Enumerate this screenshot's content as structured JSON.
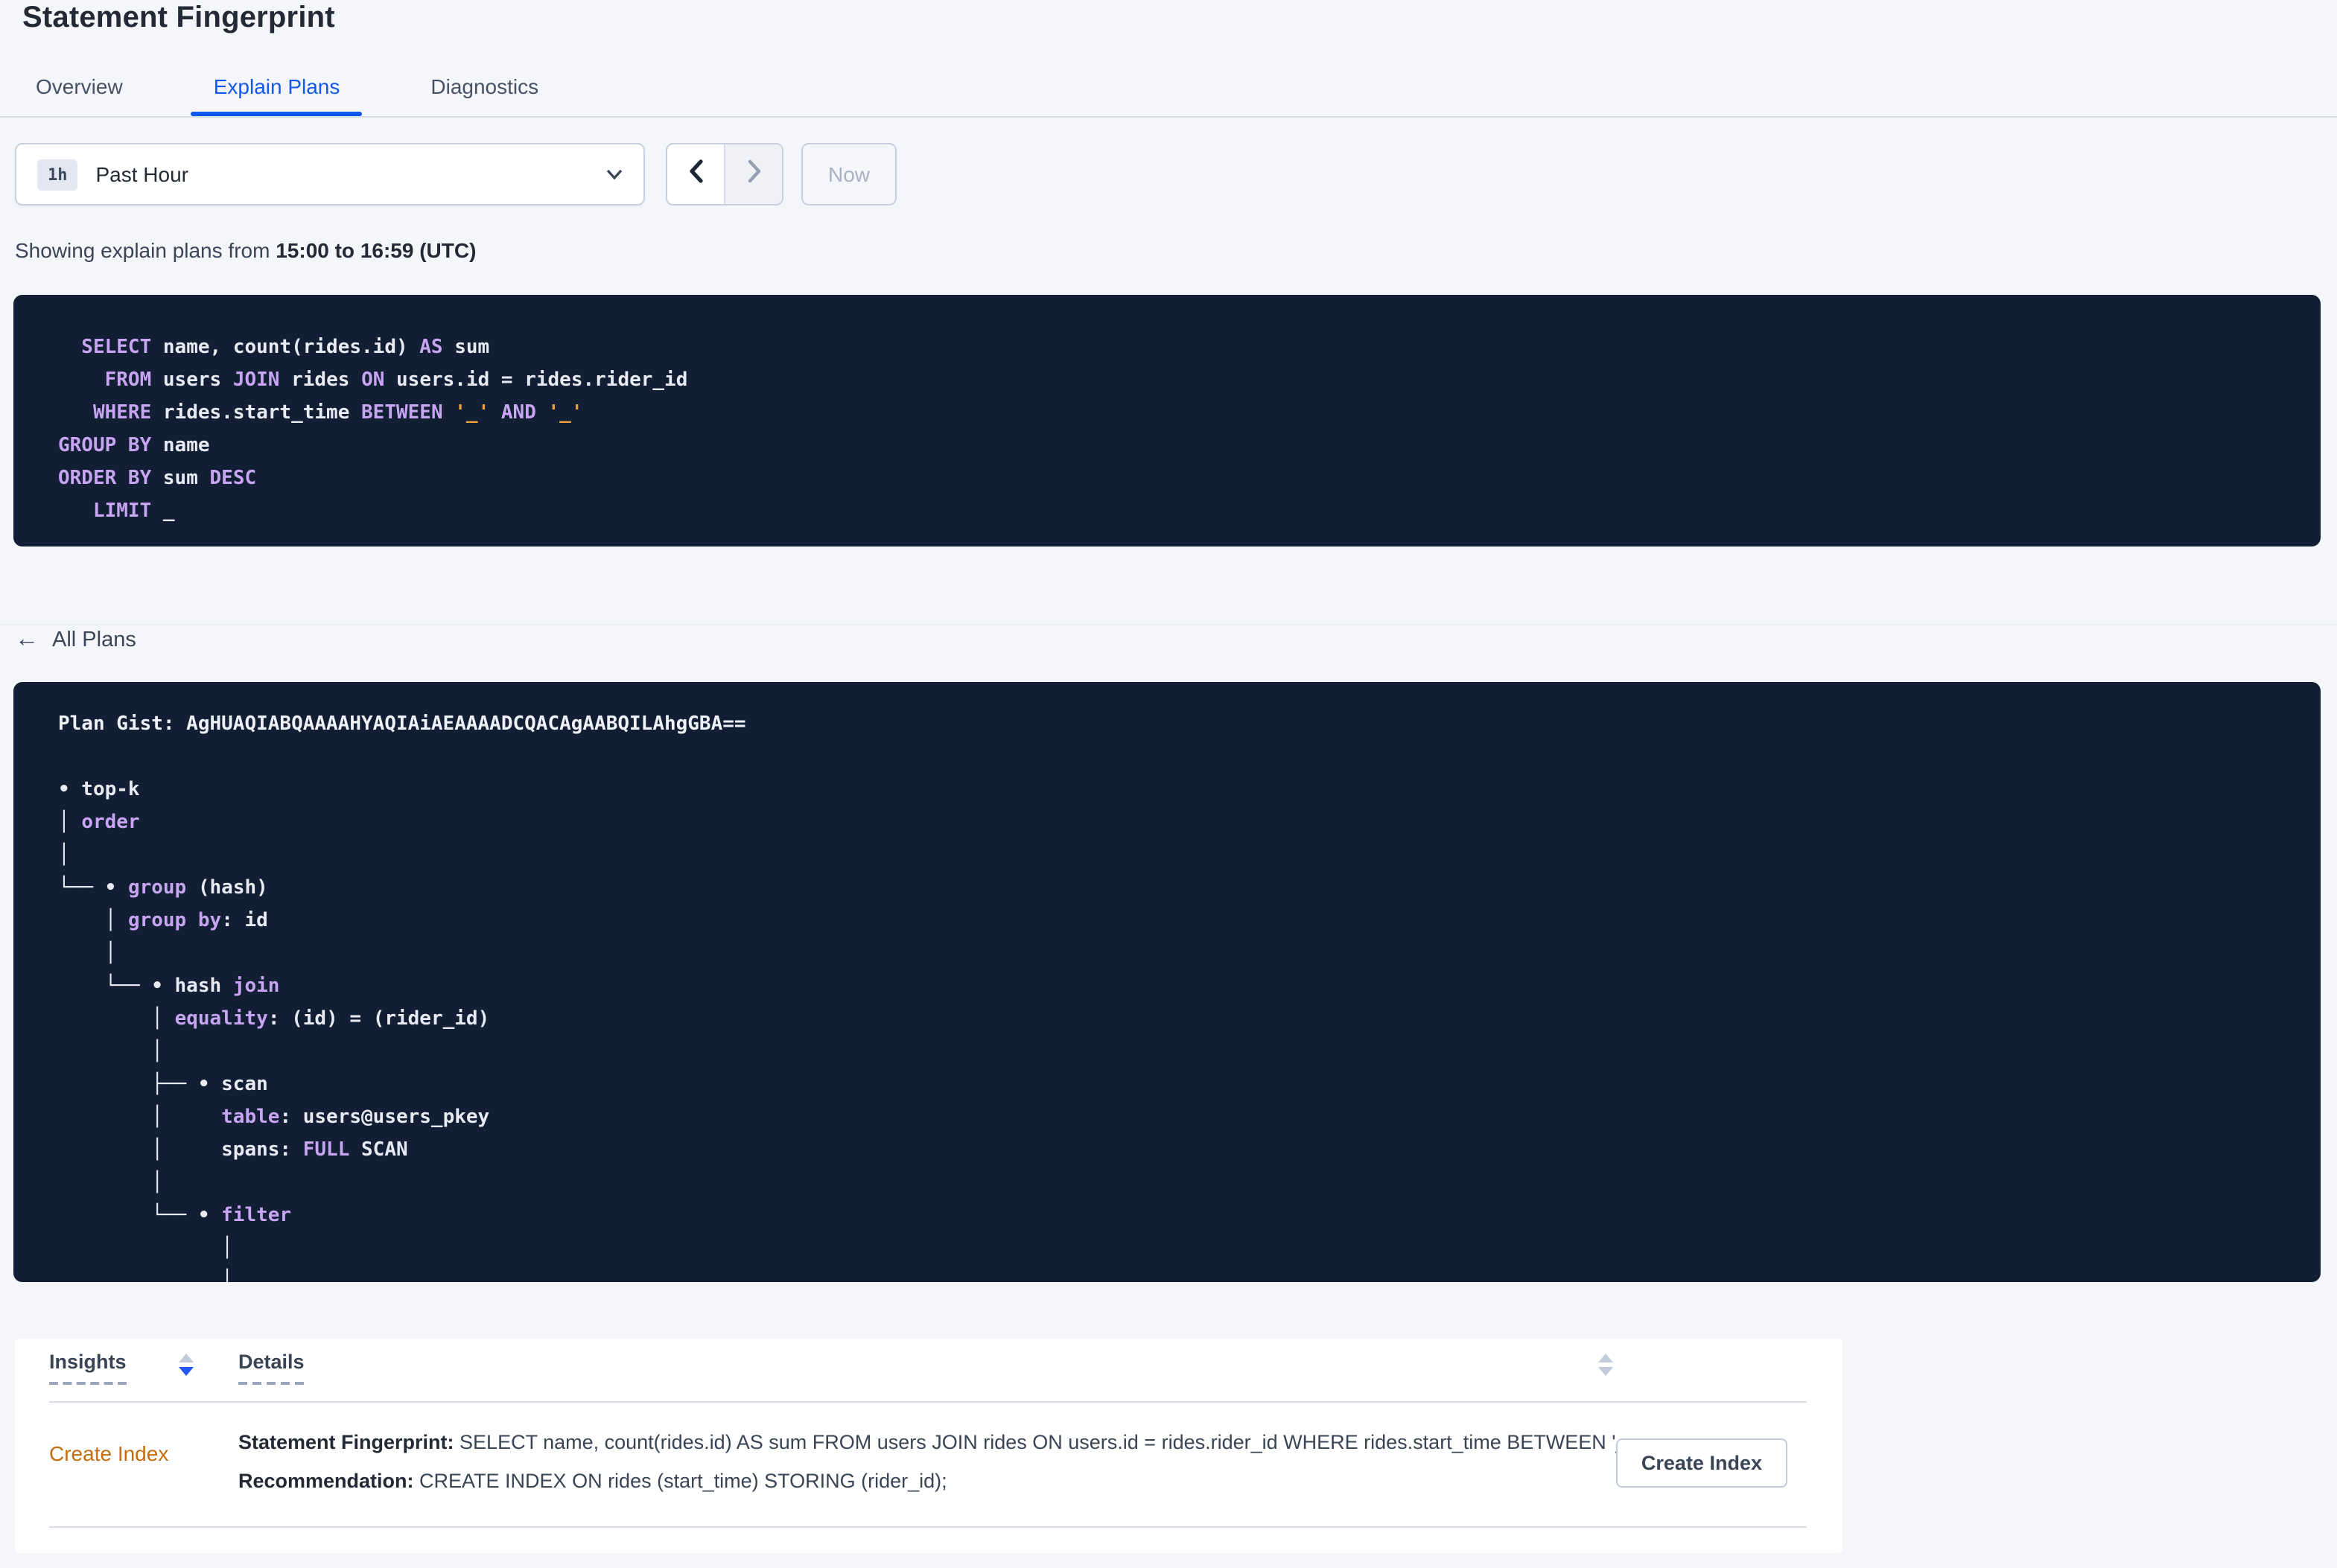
{
  "page": {
    "title": "Statement Fingerprint"
  },
  "tabs": {
    "items": [
      {
        "label": "Overview",
        "active": false
      },
      {
        "label": "Explain Plans",
        "active": true
      },
      {
        "label": "Diagnostics",
        "active": false
      }
    ]
  },
  "time_controls": {
    "duration_badge": "1h",
    "range_label": "Past Hour",
    "now_button": "Now"
  },
  "subheader": {
    "prefix": "Showing explain plans from ",
    "bold_range": "15:00 to 16:59 (UTC)"
  },
  "colors": {
    "accent_blue": "#1358ec",
    "code_background": "#121e33",
    "code_keyword": "#c7a5f2",
    "code_literal": "#f0a13e",
    "code_text": "#e8ebf3",
    "insight_link_orange": "#c26e0e"
  },
  "sql_statement": {
    "lines": [
      [
        [
          "kw",
          "  SELECT"
        ],
        [
          "pl",
          " name, count(rides.id) "
        ],
        [
          "kw",
          "AS"
        ],
        [
          "pl",
          " sum"
        ]
      ],
      [
        [
          "kw",
          "    FROM"
        ],
        [
          "pl",
          " users "
        ],
        [
          "kw",
          "JOIN"
        ],
        [
          "pl",
          " rides "
        ],
        [
          "kw",
          "ON"
        ],
        [
          "pl",
          " users.id = rides.rider_id"
        ]
      ],
      [
        [
          "kw",
          "   WHERE"
        ],
        [
          "pl",
          " rides.start_time "
        ],
        [
          "kw",
          "BETWEEN"
        ],
        [
          "pl",
          " "
        ],
        [
          "lit",
          "'_'"
        ],
        [
          "pl",
          " "
        ],
        [
          "kw",
          "AND"
        ],
        [
          "pl",
          " "
        ],
        [
          "lit",
          "'_'"
        ]
      ],
      [
        [
          "kw",
          "GROUP BY"
        ],
        [
          "pl",
          " name"
        ]
      ],
      [
        [
          "kw",
          "ORDER BY"
        ],
        [
          "pl",
          " sum "
        ],
        [
          "kw",
          "DESC"
        ]
      ],
      [
        [
          "kw",
          "   LIMIT"
        ],
        [
          "pl",
          " _"
        ]
      ]
    ]
  },
  "plan_section": {
    "back_link": "All Plans",
    "lines": [
      [
        [
          "b",
          "Plan Gist: AgHUAQIABQAAAAHYAQIAiAEAAAADCQACAgAABQILAhgGBA=="
        ]
      ],
      [
        [
          "pl",
          " "
        ]
      ],
      [
        [
          "pl",
          "• top-k"
        ]
      ],
      [
        [
          "pl",
          "│ "
        ],
        [
          "kw",
          "order"
        ]
      ],
      [
        [
          "pl",
          "│"
        ]
      ],
      [
        [
          "pl",
          "└── • "
        ],
        [
          "kw",
          "group"
        ],
        [
          "pl",
          " (hash)"
        ]
      ],
      [
        [
          "pl",
          "    │ "
        ],
        [
          "kw",
          "group by"
        ],
        [
          "pl",
          ": id"
        ]
      ],
      [
        [
          "pl",
          "    │"
        ]
      ],
      [
        [
          "pl",
          "    └── • hash "
        ],
        [
          "kw",
          "join"
        ]
      ],
      [
        [
          "pl",
          "        │ "
        ],
        [
          "kw",
          "equality"
        ],
        [
          "pl",
          ": (id) = (rider_id)"
        ]
      ],
      [
        [
          "pl",
          "        │"
        ]
      ],
      [
        [
          "pl",
          "        ├── • scan"
        ]
      ],
      [
        [
          "pl",
          "        │     "
        ],
        [
          "kw",
          "table"
        ],
        [
          "pl",
          ": users@users_pkey"
        ]
      ],
      [
        [
          "pl",
          "        │     spans: "
        ],
        [
          "kw",
          "FULL"
        ],
        [
          "pl",
          " SCAN"
        ]
      ],
      [
        [
          "pl",
          "        │"
        ]
      ],
      [
        [
          "pl",
          "        └── • "
        ],
        [
          "kw",
          "filter"
        ]
      ],
      [
        [
          "pl",
          "              │"
        ]
      ],
      [
        [
          "pl",
          "              │"
        ]
      ]
    ]
  },
  "insights_table": {
    "headers": [
      {
        "label": "Insights"
      },
      {
        "label": "Details"
      }
    ],
    "rows": [
      {
        "insight_link": "Create Index",
        "statement_label": "Statement Fingerprint:",
        "statement_value": " SELECT name, count(rides.id) AS sum FROM users JOIN rides ON users.id = rides.rider_id WHERE rides.start_time BETWEEN '_…",
        "recommendation_label": "Recommendation:",
        "recommendation_value": " CREATE INDEX ON rides (start_time) STORING (rider_id);",
        "action_button": "Create Index"
      }
    ]
  }
}
